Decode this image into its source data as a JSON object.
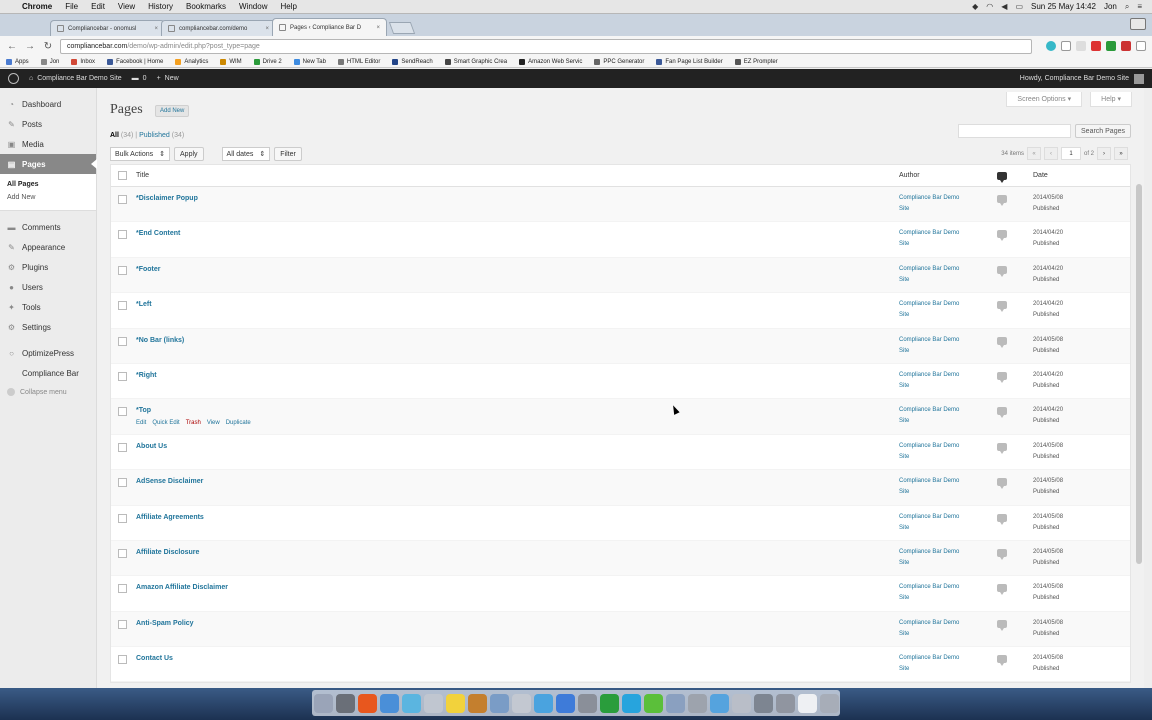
{
  "mac_menubar": {
    "app": "Chrome",
    "menus": [
      "File",
      "Edit",
      "View",
      "History",
      "Bookmarks",
      "Window",
      "Help"
    ],
    "clock": "Sun 25 May 14:42",
    "user": "Jon"
  },
  "browser": {
    "tabs": [
      {
        "title": "Compliancebar - onomusl",
        "active": false
      },
      {
        "title": "compliancebar.com/demo",
        "active": false
      },
      {
        "title": "Pages ‹ Compliance Bar D",
        "active": true
      }
    ],
    "url_host": "compliancebar.com",
    "url_path": "/demo/wp-admin/edit.php?post_type=page",
    "bookmarks": [
      {
        "label": "Apps",
        "color": "#4a7bd0"
      },
      {
        "label": "Jon",
        "color": "#888888"
      },
      {
        "label": "Inbox",
        "color": "#d14836"
      },
      {
        "label": "Facebook | Home",
        "color": "#3b5998"
      },
      {
        "label": "Analytics",
        "color": "#f4a020"
      },
      {
        "label": "WIM",
        "color": "#cc8800"
      },
      {
        "label": "Drive 2",
        "color": "#2a9a3a"
      },
      {
        "label": "New Tab",
        "color": "#3d8be0"
      },
      {
        "label": "HTML Editor",
        "color": "#777777"
      },
      {
        "label": "SendReach",
        "color": "#224488"
      },
      {
        "label": "Smart Graphic Crea",
        "color": "#444444"
      },
      {
        "label": "Amazon Web Servic",
        "color": "#222222"
      },
      {
        "label": "PPC Generator",
        "color": "#666666"
      },
      {
        "label": "Fan Page List Builder",
        "color": "#3b5998"
      },
      {
        "label": "EZ Prompter",
        "color": "#555555"
      }
    ]
  },
  "adminbar": {
    "site_name": "Compliance Bar Demo Site",
    "comments_count": "0",
    "new_label": "New",
    "howdy": "Howdy, Compliance Bar Demo Site"
  },
  "sidebar": {
    "items": [
      {
        "label": "Dashboard",
        "icon": "dashboard-icon",
        "glyph": "◔"
      },
      {
        "label": "Posts",
        "icon": "pin-icon",
        "glyph": "✎"
      },
      {
        "label": "Media",
        "icon": "media-icon",
        "glyph": "▣"
      },
      {
        "label": "Pages",
        "icon": "pages-icon",
        "glyph": "▤"
      }
    ],
    "submenu": [
      "All Pages",
      "Add New"
    ],
    "items2": [
      {
        "label": "Comments",
        "icon": "comments-icon",
        "glyph": "▬"
      },
      {
        "label": "Appearance",
        "icon": "appearance-icon",
        "glyph": "✎"
      },
      {
        "label": "Plugins",
        "icon": "plugins-icon",
        "glyph": "⚙"
      },
      {
        "label": "Users",
        "icon": "users-icon",
        "glyph": "●"
      },
      {
        "label": "Tools",
        "icon": "tools-icon",
        "glyph": "✦"
      },
      {
        "label": "Settings",
        "icon": "settings-icon",
        "glyph": "⚙"
      }
    ],
    "items3": [
      {
        "label": "OptimizePress",
        "icon": "optimizepress-icon",
        "glyph": "○"
      },
      {
        "label": "Compliance Bar",
        "icon": "compliance-icon",
        "glyph": ""
      }
    ],
    "collapse": "Collapse menu"
  },
  "main": {
    "title": "Pages",
    "add_new": "Add New",
    "screen_options": "Screen Options ▾",
    "help": "Help ▾",
    "filter_all": "All",
    "filter_all_count": "(34)",
    "filter_published": "Published",
    "filter_published_count": "(34)",
    "search_button": "Search Pages",
    "bulk_actions": "Bulk Actions",
    "apply": "Apply",
    "all_dates": "All dates",
    "filter": "Filter",
    "items_count": "34 items",
    "page_current": "1",
    "page_of": "of 2",
    "columns": {
      "title": "Title",
      "author": "Author",
      "date": "Date"
    },
    "row_actions": [
      "Edit",
      "Quick Edit",
      "Trash",
      "View",
      "Duplicate"
    ],
    "rows": [
      {
        "title": "*Disclaimer Popup",
        "author1": "Compliance Bar Demo",
        "author2": "Site",
        "date": "2014/05/08",
        "status": "Published"
      },
      {
        "title": "*End Content",
        "author1": "Compliance Bar Demo",
        "author2": "Site",
        "date": "2014/04/20",
        "status": "Published"
      },
      {
        "title": "*Footer",
        "author1": "Compliance Bar Demo",
        "author2": "Site",
        "date": "2014/04/20",
        "status": "Published"
      },
      {
        "title": "*Left",
        "author1": "Compliance Bar Demo",
        "author2": "Site",
        "date": "2014/04/20",
        "status": "Published"
      },
      {
        "title": "*No Bar (links)",
        "author1": "Compliance Bar Demo",
        "author2": "Site",
        "date": "2014/05/08",
        "status": "Published"
      },
      {
        "title": "*Right",
        "author1": "Compliance Bar Demo",
        "author2": "Site",
        "date": "2014/04/20",
        "status": "Published"
      },
      {
        "title": "*Top",
        "author1": "Compliance Bar Demo",
        "author2": "Site",
        "date": "2014/04/20",
        "status": "Published"
      },
      {
        "title": "About Us",
        "author1": "Compliance Bar Demo",
        "author2": "Site",
        "date": "2014/05/08",
        "status": "Published"
      },
      {
        "title": "AdSense Disclaimer",
        "author1": "Compliance Bar Demo",
        "author2": "Site",
        "date": "2014/05/08",
        "status": "Published"
      },
      {
        "title": "Affiliate Agreements",
        "author1": "Compliance Bar Demo",
        "author2": "Site",
        "date": "2014/05/08",
        "status": "Published"
      },
      {
        "title": "Affiliate Disclosure",
        "author1": "Compliance Bar Demo",
        "author2": "Site",
        "date": "2014/05/08",
        "status": "Published"
      },
      {
        "title": "Amazon Affiliate Disclaimer",
        "author1": "Compliance Bar Demo",
        "author2": "Site",
        "date": "2014/05/08",
        "status": "Published"
      },
      {
        "title": "Anti-Spam Policy",
        "author1": "Compliance Bar Demo",
        "author2": "Site",
        "date": "2014/05/08",
        "status": "Published"
      },
      {
        "title": "Contact Us",
        "author1": "Compliance Bar Demo",
        "author2": "Site",
        "date": "2014/05/08",
        "status": "Published"
      }
    ]
  },
  "dock_colors": [
    "#9aa4b8",
    "#6a6f78",
    "#e8571e",
    "#4a8fd8",
    "#5bb5e0",
    "#c0c6d0",
    "#f2d23c",
    "#c47f2e",
    "#7a9cc6",
    "#c3c8d1",
    "#4aa3df",
    "#3e7bd9",
    "#8a8f99",
    "#2a9d3c",
    "#27a4dd",
    "#5bbf3a",
    "#8aa0c0",
    "#9da3ad",
    "#55a3de",
    "#b9bec8",
    "#7d8591",
    "#9095a0",
    "#eef0f3",
    "#a7adb8"
  ]
}
